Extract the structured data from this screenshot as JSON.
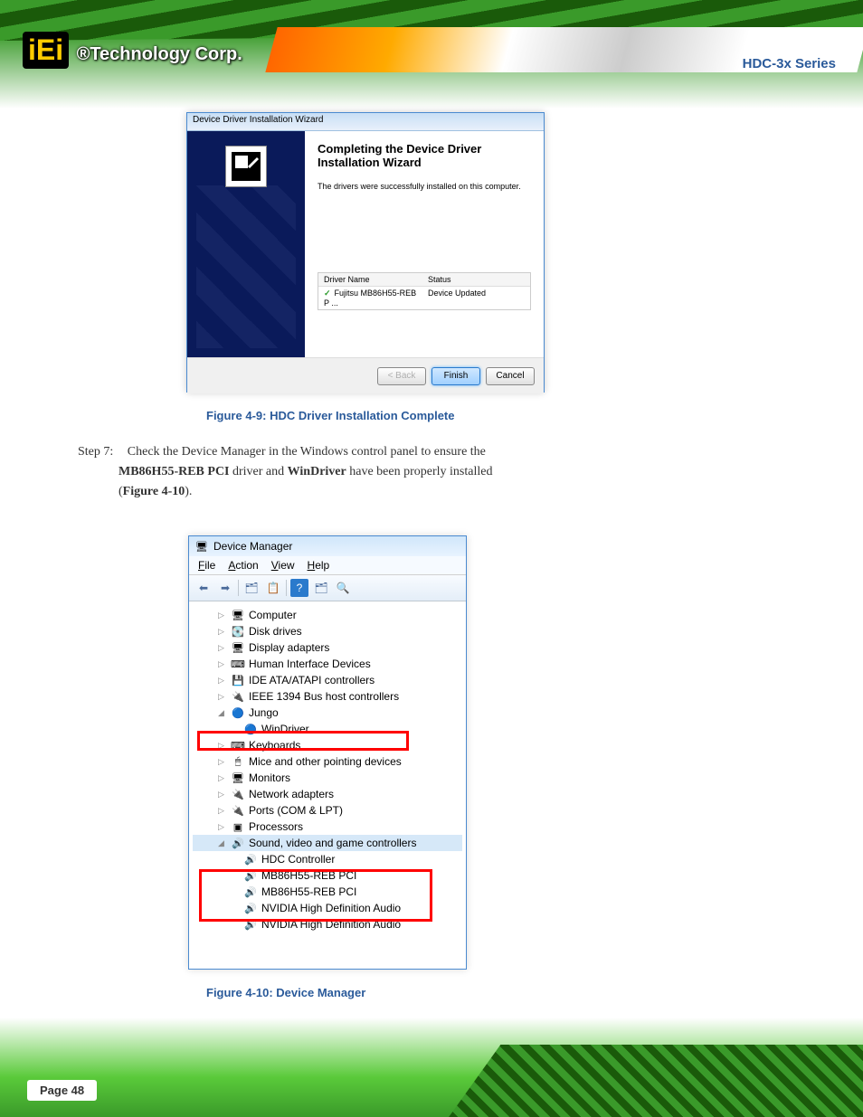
{
  "brand": {
    "logo": "iEi",
    "tagline": "®Technology Corp."
  },
  "doc_header": "HDC-3x Series",
  "installer": {
    "title": "Device Driver Installation Wizard",
    "heading": "Completing the Device Driver Installation Wizard",
    "message": "The drivers were successfully installed on this computer.",
    "table_header_name": "Driver Name",
    "table_header_status": "Status",
    "rows": [
      {
        "name": "Fujitsu MB86H55-REB P ...",
        "status": "Device Updated"
      }
    ],
    "buttons": {
      "back": "< Back",
      "finish": "Finish",
      "cancel": "Cancel"
    }
  },
  "caption1": "Figure 4-9: HDC Driver Installation Complete",
  "step7_label": "Step 7:",
  "step7_text": "Check the Device Manager in the Windows control panel to ensure the",
  "step7_text2": "MB86H55-REB PCI driver and WinDriver have been properly installed",
  "step7_text3": "(Figure 4-10).",
  "devmgr": {
    "title": "Device Manager",
    "menu": {
      "file": "File",
      "action": "Action",
      "view": "View",
      "help": "Help"
    },
    "items": [
      "Computer",
      "Disk drives",
      "Display adapters",
      "Human Interface Devices",
      "IDE ATA/ATAPI controllers",
      "IEEE 1394 Bus host controllers",
      "Jungo",
      "WinDriver",
      "Keyboards",
      "Mice and other pointing devices",
      "Monitors",
      "Network adapters",
      "Ports (COM & LPT)",
      "Processors",
      "Sound, video and game controllers",
      "HDC Controller",
      "MB86H55-REB PCI",
      "MB86H55-REB PCI",
      "NVIDIA High Definition Audio",
      "NVIDIA High Definition Audio"
    ]
  },
  "caption2": "Figure 4-10: Device Manager",
  "page_number": "Page 48"
}
